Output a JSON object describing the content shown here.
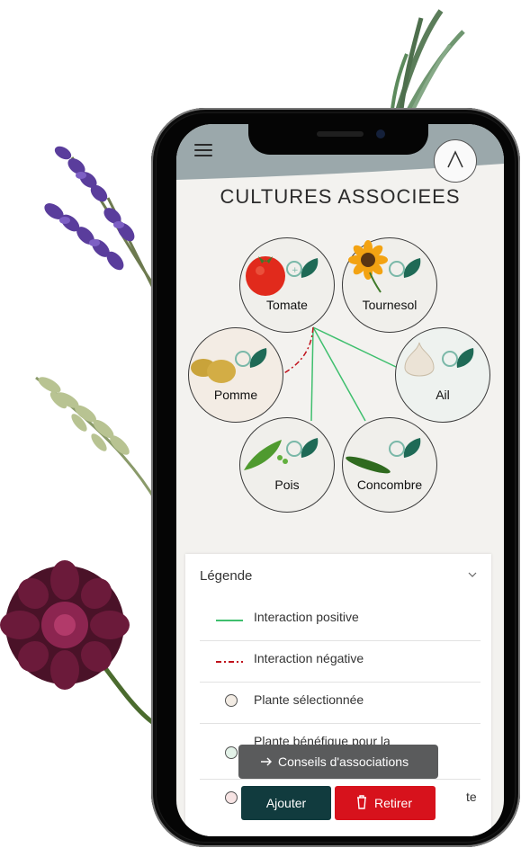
{
  "app": {
    "title": "CULTURES ASSOCIEES"
  },
  "plants": [
    {
      "id": "tomate",
      "name": "Tomate",
      "state": "default"
    },
    {
      "id": "tournesol",
      "name": "Tournesol",
      "state": "default"
    },
    {
      "id": "pomme",
      "name": "Pomme",
      "state": "selected"
    },
    {
      "id": "ail",
      "name": "Ail",
      "state": "positive"
    },
    {
      "id": "pois",
      "name": "Pois",
      "state": "default"
    },
    {
      "id": "concombre",
      "name": "Concombre",
      "state": "default"
    }
  ],
  "legend": {
    "title": "Légende",
    "items": [
      {
        "type": "line",
        "color": "#3fbf6e",
        "label": "Interaction positive"
      },
      {
        "type": "dashdot",
        "color": "#c0121c",
        "label": "Interaction négative"
      },
      {
        "type": "dot",
        "color": "#f3ece4",
        "label": "Plante sélectionnée"
      },
      {
        "type": "dot",
        "color": "#e3f2e8",
        "label": "Plante bénéfique pour la"
      },
      {
        "type": "dot",
        "color": "#f7e4e4",
        "label": "te"
      }
    ]
  },
  "buttons": {
    "conseils": "Conseils d'associations",
    "ajouter": "Ajouter",
    "retirer": "Retirer"
  },
  "colors": {
    "positive": "#3fbf6e",
    "negative": "#c0121c",
    "accent": "#113b3e",
    "danger": "#d7121c"
  }
}
